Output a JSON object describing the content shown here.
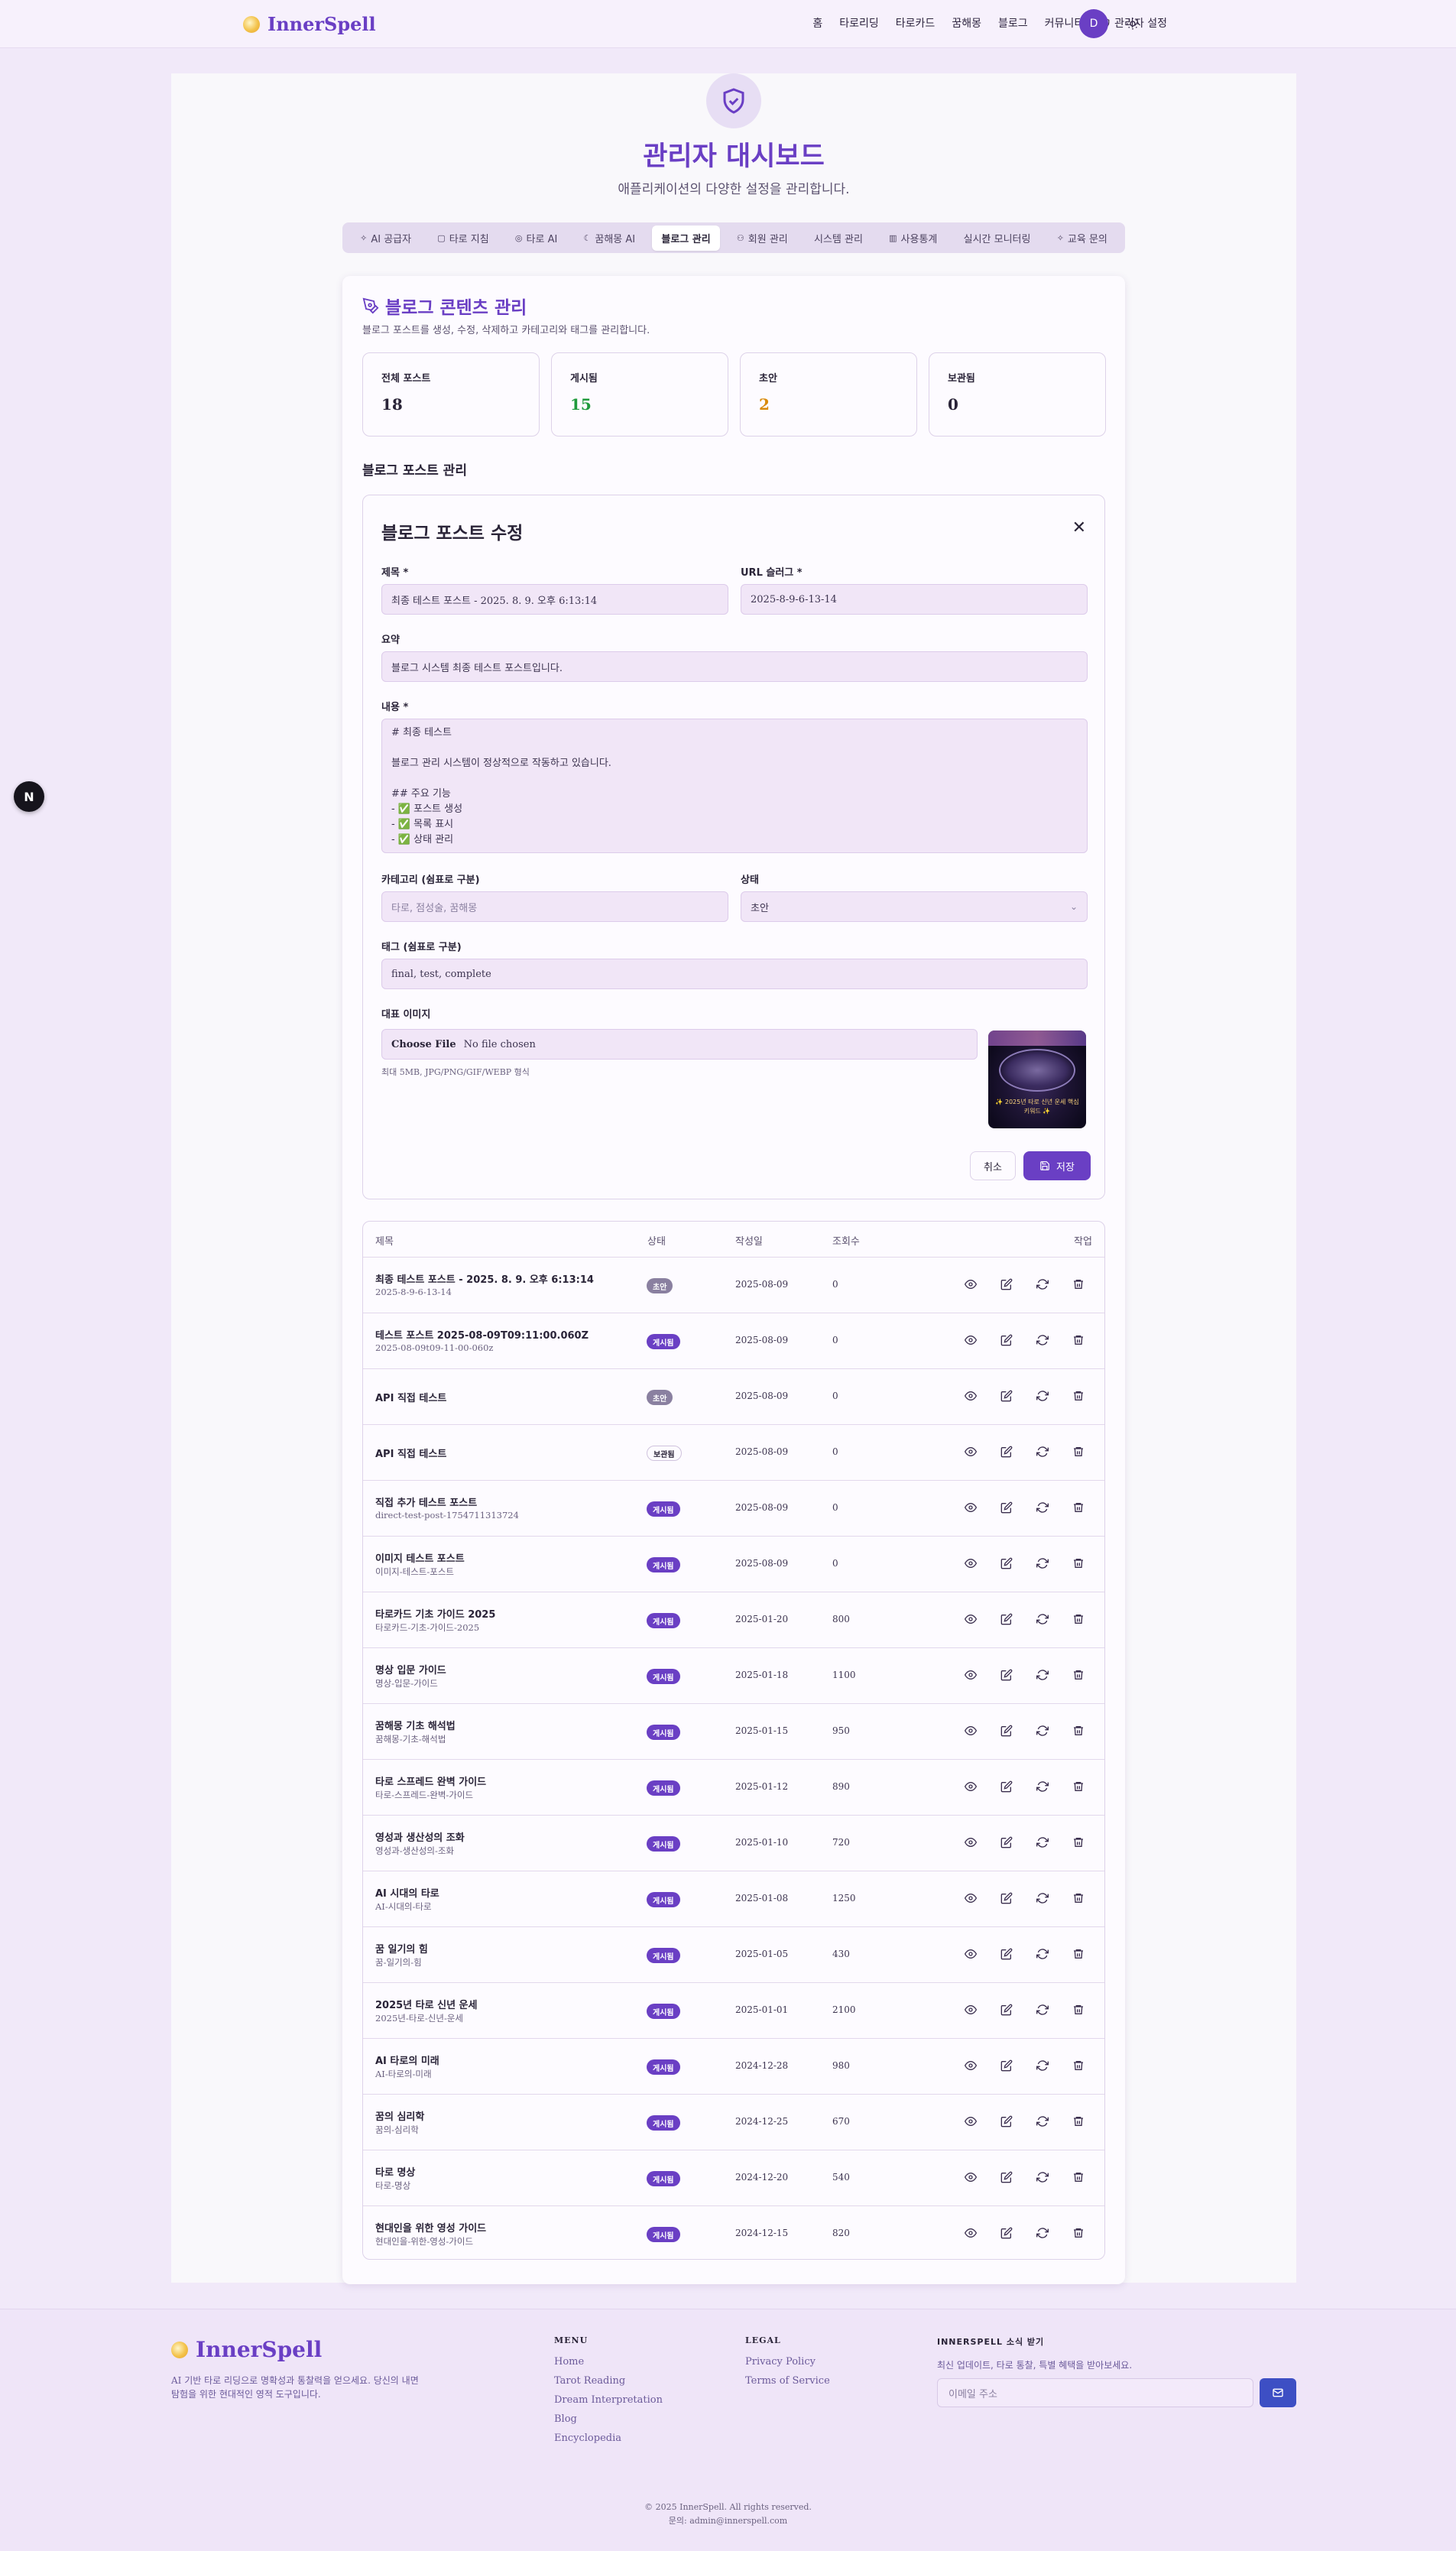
{
  "header": {
    "logo": "InnerSpell",
    "nav": [
      "홈",
      "타로리딩",
      "타로카드",
      "꿈해몽",
      "블로그",
      "커뮤니티"
    ],
    "admin_link": "관리자 설정",
    "avatar": "D"
  },
  "page": {
    "title": "관리자 대시보드",
    "subtitle": "애플리케이션의 다양한 설정을 관리합니다."
  },
  "tabs": [
    {
      "label": "AI 공급자",
      "icon": "sparkle-icon"
    },
    {
      "label": "타로 지침",
      "icon": "book-icon"
    },
    {
      "label": "타로 AI",
      "icon": "target-icon"
    },
    {
      "label": "꿈해몽 AI",
      "icon": "moon-icon"
    },
    {
      "label": "블로그 관리",
      "icon": "",
      "active": true
    },
    {
      "label": "회원 관리",
      "icon": "users-icon"
    },
    {
      "label": "시스템 관리",
      "icon": ""
    },
    {
      "label": "사용통계",
      "icon": "chart-icon"
    },
    {
      "label": "실시간 모니터링",
      "icon": ""
    },
    {
      "label": "교육 문의",
      "icon": "sparkle-icon"
    }
  ],
  "blog": {
    "title": "블로그 콘텐츠 관리",
    "subtitle": "블로그 포스트를 생성, 수정, 삭제하고 카테고리와 태그를 관리합니다.",
    "stats": [
      {
        "label": "전체 포스트",
        "value": "18",
        "color": "#2a2438"
      },
      {
        "label": "게시됨",
        "value": "15",
        "color": "#1f9a3c"
      },
      {
        "label": "초안",
        "value": "2",
        "color": "#d98a0a"
      },
      {
        "label": "보관됨",
        "value": "0",
        "color": "#2a2438"
      }
    ],
    "section_title": "블로그 포스트 관리"
  },
  "form": {
    "title": "블로그 포스트 수정",
    "title_label": "제목 *",
    "title_value": "최종 테스트 포스트 - 2025. 8. 9. 오후 6:13:14",
    "slug_label": "URL 슬러그 *",
    "slug_value": "2025-8-9-6-13-14",
    "summary_label": "요약",
    "summary_value": "블로그 시스템 최종 테스트 포스트입니다.",
    "content_label": "내용 *",
    "content_value": "# 최종 테스트\n\n블로그 관리 시스템이 정상적으로 작동하고 있습니다.\n\n## 주요 기능\n- ✅ 포스트 생성\n- ✅ 목록 표시\n- ✅ 상태 관리",
    "category_label": "카테고리 (쉼표로 구분)",
    "category_placeholder": "타로, 점성술, 꿈해몽",
    "status_label": "상태",
    "status_value": "초안",
    "tags_label": "태그 (쉼표로 구분)",
    "tags_value": "final, test, complete",
    "image_label": "대표 이미지",
    "file_button": "Choose File",
    "file_status": "No file chosen",
    "file_hint": "최대 5MB, JPG/PNG/GIF/WEBP 형식",
    "thumb_caption": "✨ 2025년 타로 신년 운세 핵심 키워드 ✨",
    "cancel": "취소",
    "save": "저장"
  },
  "table": {
    "headers": {
      "title": "제목",
      "status": "상태",
      "date": "작성일",
      "views": "조회수",
      "actions": "작업"
    },
    "rows": [
      {
        "title": "최종 테스트 포스트 - 2025. 8. 9. 오후 6:13:14",
        "slug": "2025-8-9-6-13-14",
        "status": "초안",
        "kind": "draft",
        "date": "2025-08-09",
        "views": "0"
      },
      {
        "title": "테스트 포스트 2025-08-09T09:11:00.060Z",
        "slug": "2025-08-09t09-11-00-060z",
        "status": "게시됨",
        "kind": "pub",
        "date": "2025-08-09",
        "views": "0"
      },
      {
        "title": "API 직접 테스트",
        "slug": "",
        "status": "초안",
        "kind": "draft",
        "date": "2025-08-09",
        "views": "0"
      },
      {
        "title": "API 직접 테스트",
        "slug": "",
        "status": "보관됨",
        "kind": "arch",
        "date": "2025-08-09",
        "views": "0"
      },
      {
        "title": "직접 추가 테스트 포스트",
        "slug": "direct-test-post-1754711313724",
        "status": "게시됨",
        "kind": "pub",
        "date": "2025-08-09",
        "views": "0"
      },
      {
        "title": "이미지 테스트 포스트",
        "slug": "이미지-테스트-포스트",
        "status": "게시됨",
        "kind": "pub",
        "date": "2025-08-09",
        "views": "0"
      },
      {
        "title": "타로카드 기초 가이드 2025",
        "slug": "타로카드-기초-가이드-2025",
        "status": "게시됨",
        "kind": "pub",
        "date": "2025-01-20",
        "views": "800"
      },
      {
        "title": "명상 입문 가이드",
        "slug": "명상-입문-가이드",
        "status": "게시됨",
        "kind": "pub",
        "date": "2025-01-18",
        "views": "1100"
      },
      {
        "title": "꿈해몽 기초 해석법",
        "slug": "꿈해몽-기초-해석법",
        "status": "게시됨",
        "kind": "pub",
        "date": "2025-01-15",
        "views": "950"
      },
      {
        "title": "타로 스프레드 완벽 가이드",
        "slug": "타로-스프레드-완벽-가이드",
        "status": "게시됨",
        "kind": "pub",
        "date": "2025-01-12",
        "views": "890"
      },
      {
        "title": "영성과 생산성의 조화",
        "slug": "영성과-생산성의-조화",
        "status": "게시됨",
        "kind": "pub",
        "date": "2025-01-10",
        "views": "720"
      },
      {
        "title": "AI 시대의 타로",
        "slug": "AI-시대의-타로",
        "status": "게시됨",
        "kind": "pub",
        "date": "2025-01-08",
        "views": "1250"
      },
      {
        "title": "꿈 일기의 힘",
        "slug": "꿈-일기의-힘",
        "status": "게시됨",
        "kind": "pub",
        "date": "2025-01-05",
        "views": "430"
      },
      {
        "title": "2025년 타로 신년 운세",
        "slug": "2025년-타로-신년-운세",
        "status": "게시됨",
        "kind": "pub",
        "date": "2025-01-01",
        "views": "2100"
      },
      {
        "title": "AI 타로의 미래",
        "slug": "AI-타로의-미래",
        "status": "게시됨",
        "kind": "pub",
        "date": "2024-12-28",
        "views": "980"
      },
      {
        "title": "꿈의 심리학",
        "slug": "꿈의-심리학",
        "status": "게시됨",
        "kind": "pub",
        "date": "2024-12-25",
        "views": "670"
      },
      {
        "title": "타로 명상",
        "slug": "타로-명상",
        "status": "게시됨",
        "kind": "pub",
        "date": "2024-12-20",
        "views": "540"
      },
      {
        "title": "현대인을 위한 영성 가이드",
        "slug": "현대인을-위한-영성-가이드",
        "status": "게시됨",
        "kind": "pub",
        "date": "2024-12-15",
        "views": "820"
      }
    ]
  },
  "fab": "N",
  "footer": {
    "logo": "InnerSpell",
    "desc": "AI 기반 타로 리딩으로 명확성과 통찰력을 얻으세요. 당신의 내면 탐험을 위한 현대적인 영적 도구입니다.",
    "menu_head": "MENU",
    "menu": [
      "Home",
      "Tarot Reading",
      "Dream Interpretation",
      "Blog",
      "Encyclopedia"
    ],
    "legal_head": "LEGAL",
    "legal": [
      "Privacy Policy",
      "Terms of Service"
    ],
    "news_head": "INNERSPELL 소식 받기",
    "news_desc": "최신 업데이트, 타로 통찰, 특별 혜택을 받아보세요.",
    "email_placeholder": "이메일 주소",
    "copyright": "© 2025 InnerSpell. All rights reserved.",
    "contact": "문의: admin@innerspell.com"
  }
}
